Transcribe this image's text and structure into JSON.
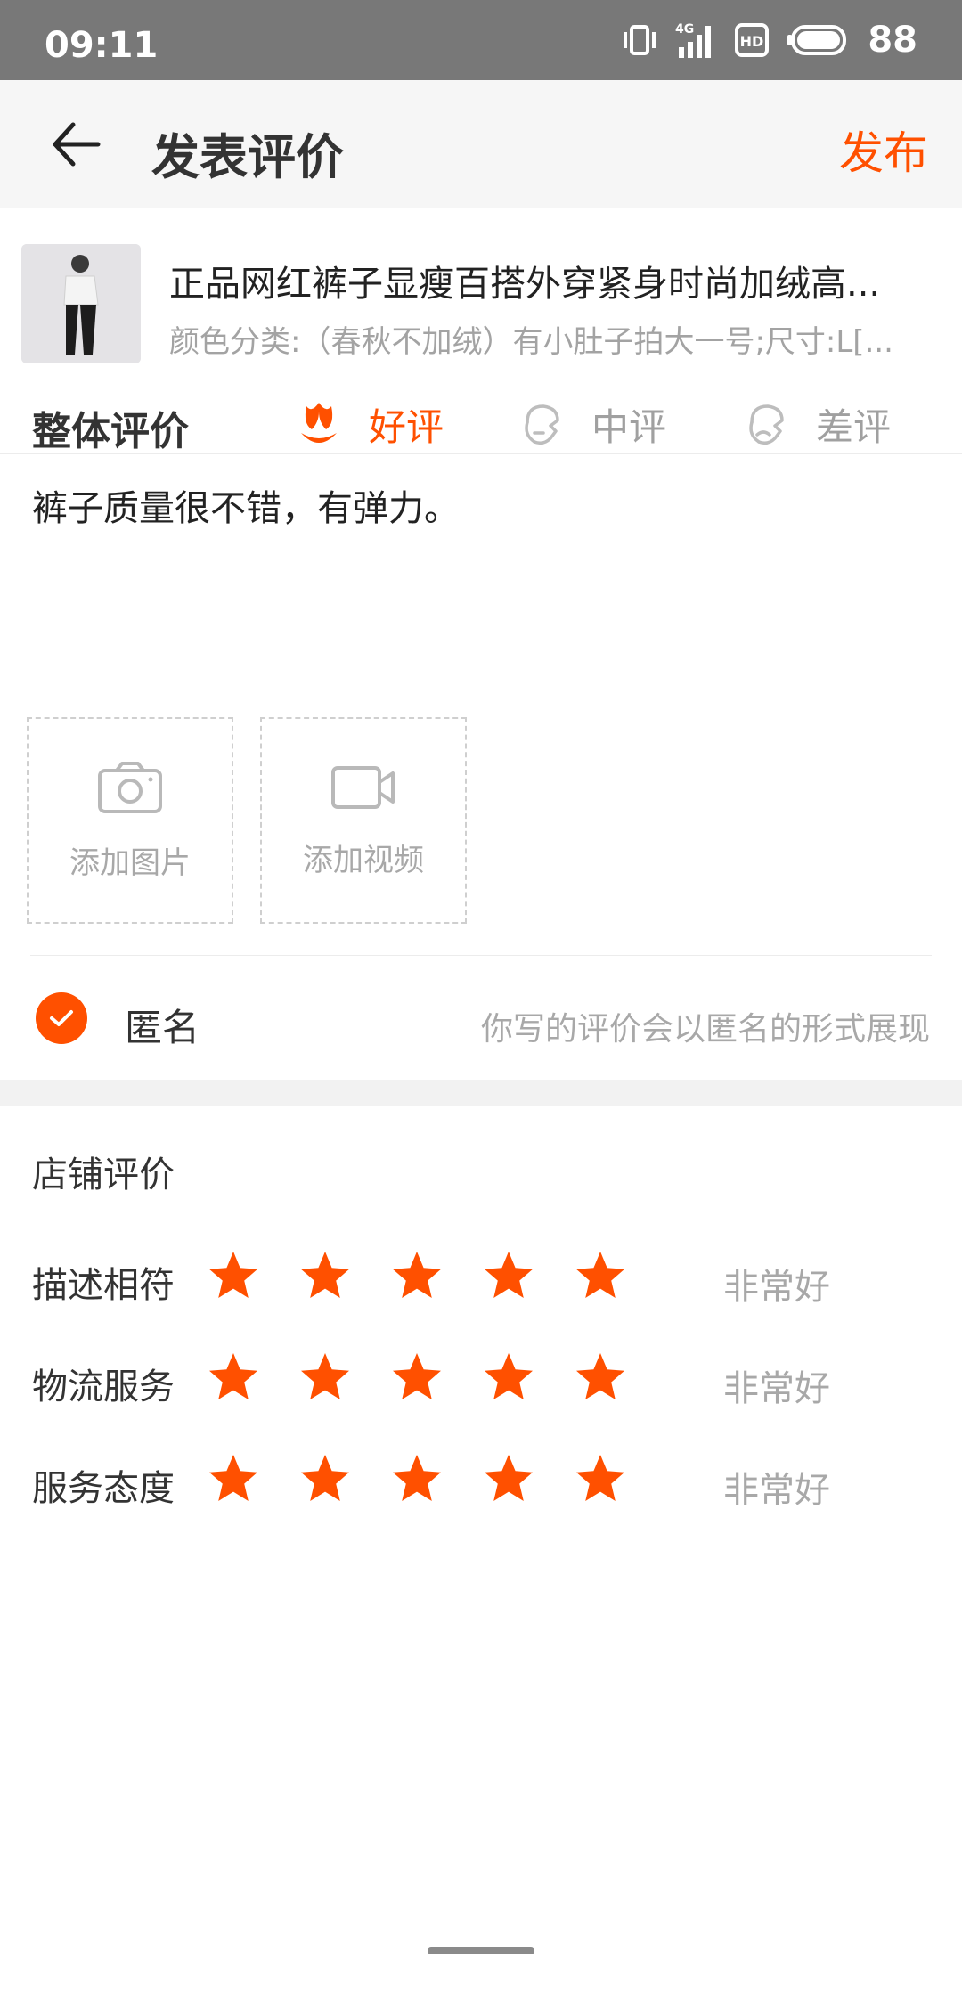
{
  "status_bar": {
    "time": "09:11",
    "signal_type": "4G",
    "hd_label": "HD",
    "battery_level": "88"
  },
  "header": {
    "title": "发表评价",
    "publish_label": "发布",
    "accent_color": "#ff5000"
  },
  "product": {
    "title": "正品网红裤子显瘦百搭外穿紧身时尚加绒高...",
    "spec": "颜色分类:（春秋不加绒）有小肚子拍大一号;尺寸:L[..."
  },
  "overall_rating": {
    "label": "整体评价",
    "options": [
      {
        "label": "好评",
        "icon": "flower-icon",
        "selected": true
      },
      {
        "label": "中评",
        "icon": "neutral-face-icon",
        "selected": false
      },
      {
        "label": "差评",
        "icon": "sad-face-icon",
        "selected": false
      }
    ]
  },
  "review": {
    "text": "裤子质量很不错，有弹力。"
  },
  "upload": {
    "photo_label": "添加图片",
    "video_label": "添加视频"
  },
  "anonymous": {
    "label": "匿名",
    "hint": "你写的评价会以匿名的形式展现",
    "checked": true
  },
  "shop_rating": {
    "title": "店铺评价",
    "rows": [
      {
        "label": "描述相符",
        "stars": 5,
        "max_stars": 5,
        "value_text": "非常好"
      },
      {
        "label": "物流服务",
        "stars": 5,
        "max_stars": 5,
        "value_text": "非常好"
      },
      {
        "label": "服务态度",
        "stars": 5,
        "max_stars": 5,
        "value_text": "非常好"
      }
    ]
  }
}
